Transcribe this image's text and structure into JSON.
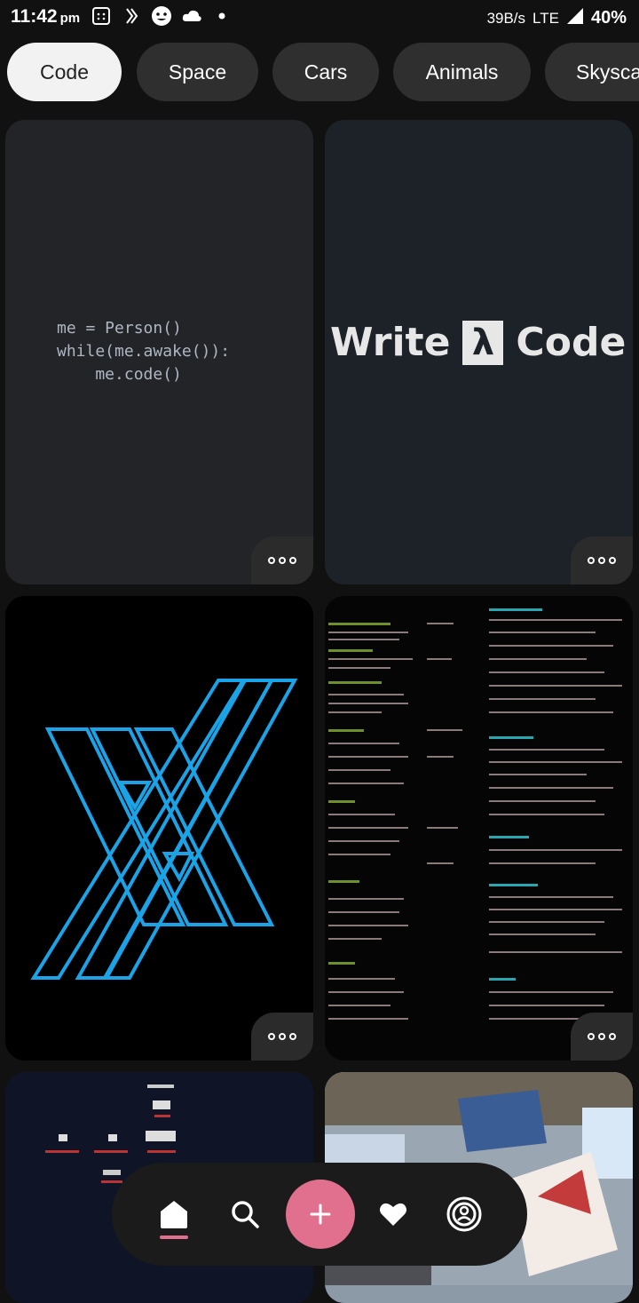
{
  "status": {
    "time": "11:42",
    "ampm": "pm",
    "speed": "39B/s",
    "network": "LTE",
    "battery": "40%"
  },
  "categories": [
    "Code",
    "Space",
    "Cars",
    "Animals",
    "Skysca"
  ],
  "active_category": "Code",
  "cards": {
    "code_snippet": [
      "me = Person()",
      "while(me.awake()):",
      "    me.code()"
    ],
    "write_code": {
      "left": "Write",
      "lambda": "λ",
      "right": "Code"
    }
  },
  "nav": {
    "items": [
      "home-icon",
      "search-icon",
      "plus-icon",
      "heart-icon",
      "profile-icon"
    ],
    "accent": "#e0708e"
  },
  "colors": {
    "background": "#111111",
    "chip": "#2f2f2f",
    "chip_active": "#f2f2f2"
  }
}
